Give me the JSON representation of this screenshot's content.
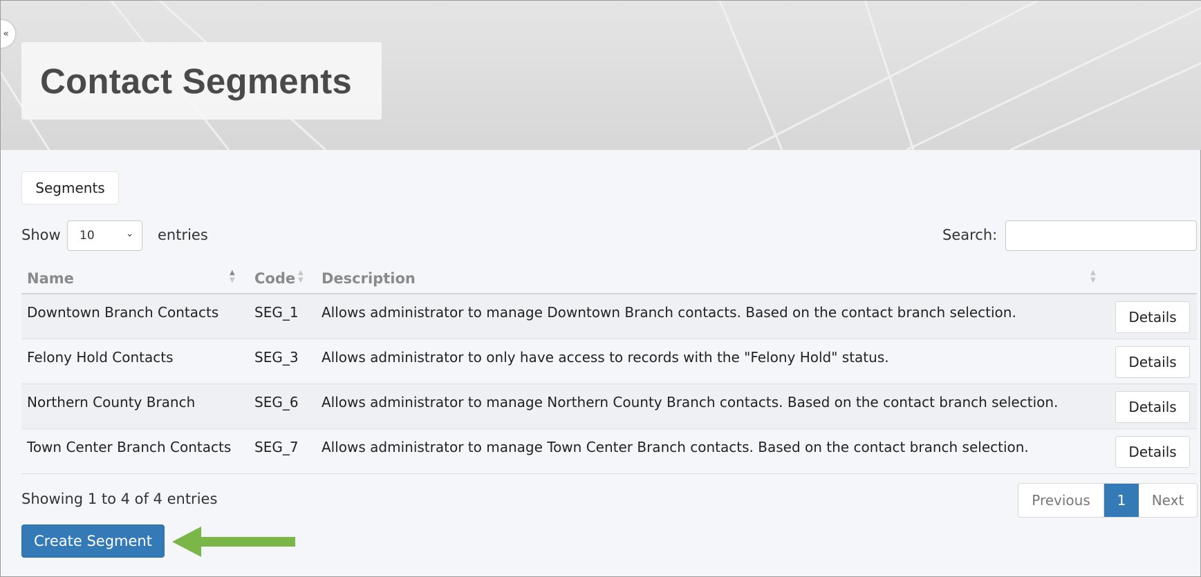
{
  "header": {
    "title": "Contact Segments",
    "toggle_glyph": "«"
  },
  "tabs": [
    {
      "label": "Segments"
    }
  ],
  "controls": {
    "show_label": "Show",
    "length_value": "10",
    "entries_label": "entries",
    "search_label": "Search:",
    "search_value": "",
    "chevron_glyph": "⌄"
  },
  "table": {
    "columns": [
      "Name",
      "Code",
      "Description"
    ],
    "sorted_column": "Name",
    "sort_direction": "ascending",
    "rows": [
      {
        "name": "Downtown Branch Contacts",
        "code": "SEG_1",
        "description": "Allows administrator to manage Downtown Branch contacts. Based on the contact branch selection.",
        "action": "Details"
      },
      {
        "name": "Felony Hold Contacts",
        "code": "SEG_3",
        "description": "Allows administrator to only have access to records with the \"Felony Hold\" status.",
        "action": "Details"
      },
      {
        "name": "Northern County Branch",
        "code": "SEG_6",
        "description": "Allows administrator to manage Northern County Branch contacts. Based on the contact branch selection.",
        "action": "Details"
      },
      {
        "name": "Town Center Branch Contacts",
        "code": "SEG_7",
        "description": "Allows administrator to manage Town Center Branch contacts. Based on the contact branch selection.",
        "action": "Details"
      }
    ]
  },
  "footer": {
    "info": "Showing 1 to 4 of 4 entries",
    "pagination": {
      "previous": "Previous",
      "current": "1",
      "next": "Next"
    },
    "create_button": "Create Segment"
  },
  "annotation": {
    "arrow_color": "#7ab648",
    "points_to": "create-segment-button"
  },
  "colors": {
    "primary": "#337ab7",
    "page_background": "#f4f6fa",
    "striped_row": "#eef0f3"
  }
}
